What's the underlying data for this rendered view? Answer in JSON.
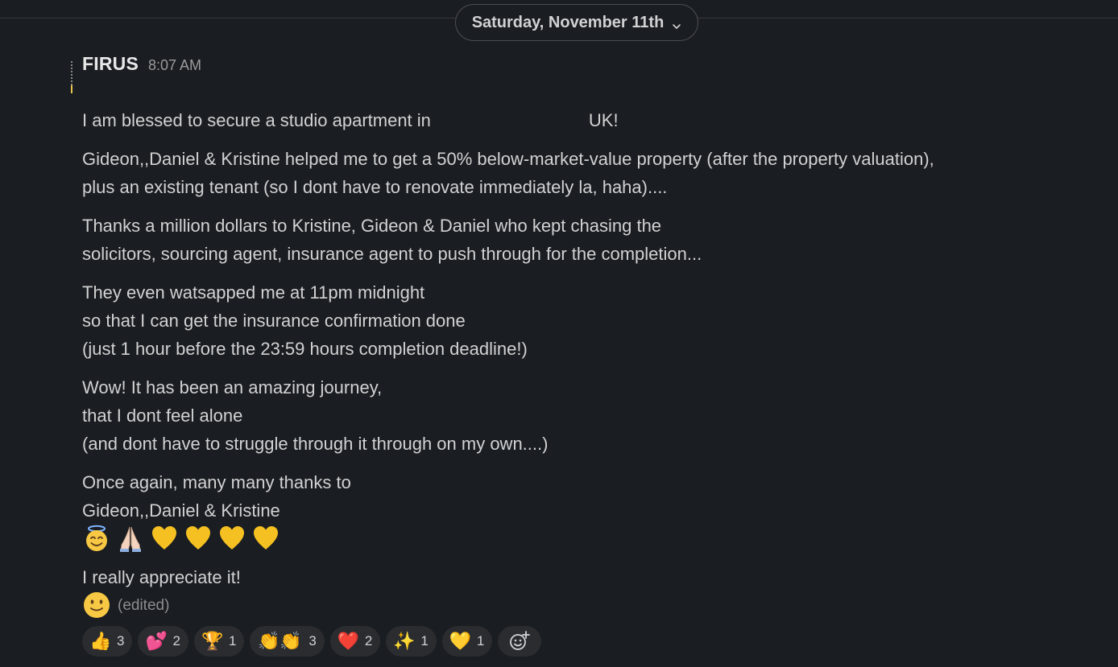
{
  "date_divider": {
    "label": "Saturday, November 11th",
    "icon": "chevron-down-icon"
  },
  "message": {
    "author": "FIRUS",
    "timestamp": "8:07 AM",
    "paragraphs": [
      [
        "I am blessed to secure a studio apartment in",
        "UK!"
      ],
      [
        "Gideon,,Daniel & Kristine helped me to get a 50% below-market-value property (after the property valuation),",
        "plus an existing tenant (so I dont have to renovate immediately la, haha)...."
      ],
      [
        "Thanks a million dollars to Kristine, Gideon & Daniel who kept chasing the",
        "solicitors, sourcing agent, insurance agent to push through for the completion..."
      ],
      [
        "They even watsapped me at 11pm midnight",
        "so that I can get the insurance confirmation done",
        "(just 1 hour before the 23:59 hours completion deadline!)"
      ],
      [
        "Wow! It has been an amazing journey,",
        "that I dont feel alone",
        "(and dont have to struggle through it through on my own....)"
      ],
      [
        "Once again, many many thanks to",
        "Gideon,,Daniel & Kristine"
      ]
    ],
    "emoji_line": [
      "smiling-face-with-halo",
      "folded-hands",
      "yellow-heart",
      "yellow-heart",
      "yellow-heart",
      "yellow-heart"
    ],
    "closing": "I really appreciate it!",
    "closing_emoji": "slightly-smiling-face",
    "edited_label": "(edited)"
  },
  "reactions": [
    {
      "emoji": "👍",
      "name": "thumbs-up",
      "count": "3"
    },
    {
      "emoji": "💕",
      "name": "two-hearts",
      "count": "2"
    },
    {
      "emoji": "🏆",
      "name": "trophy",
      "count": "1"
    },
    {
      "emoji": "👏👏",
      "name": "clapping-hands",
      "count": "3"
    },
    {
      "emoji": "❤️",
      "name": "red-heart",
      "count": "2"
    },
    {
      "emoji": "✨",
      "name": "sparkles",
      "count": "1"
    },
    {
      "emoji": "💛",
      "name": "yellow-heart",
      "count": "1"
    }
  ],
  "add_reaction_icon": "add-reaction-icon",
  "colors": {
    "background": "#1a1d21",
    "text": "#d1d2d3",
    "muted": "#9a9b9c",
    "pill_bg": "#2a2c30",
    "border": "#4a4c50"
  }
}
